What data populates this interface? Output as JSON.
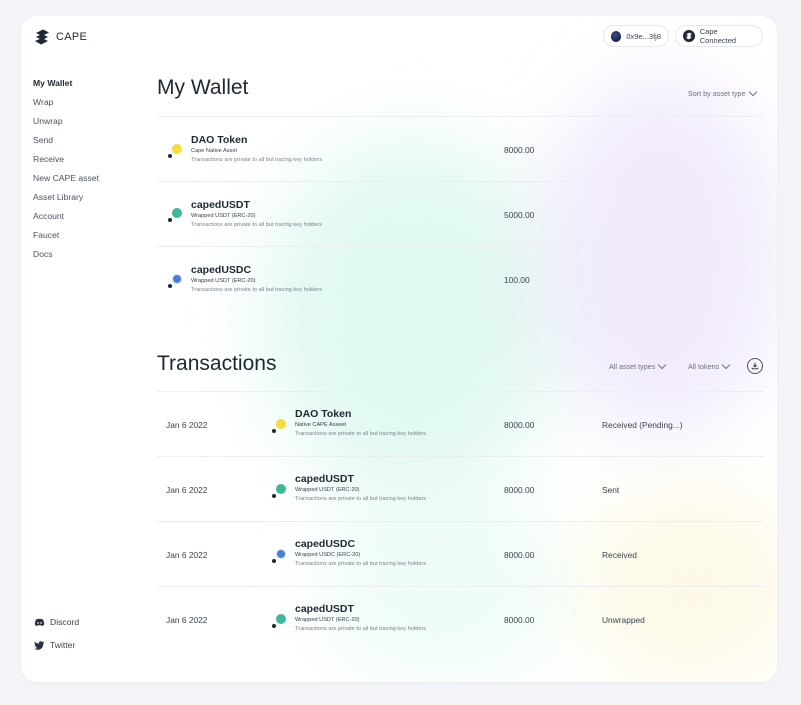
{
  "app": {
    "name": "CAPE"
  },
  "header": {
    "address": "0x9e...3fj8",
    "connection": "Cape Connected"
  },
  "nav": {
    "items": [
      {
        "label": "My Wallet",
        "active": true
      },
      {
        "label": "Wrap"
      },
      {
        "label": "Unwrap"
      },
      {
        "label": "Send"
      },
      {
        "label": "Receive"
      },
      {
        "label": "New CAPE asset"
      },
      {
        "label": "Asset Library"
      },
      {
        "label": "Account"
      },
      {
        "label": "Faucet"
      },
      {
        "label": "Docs"
      }
    ]
  },
  "social": {
    "discord": "Discord",
    "twitter": "Twitter"
  },
  "wallet": {
    "title": "My Wallet",
    "sort_label": "Sort by asset type",
    "assets": [
      {
        "name": "DAO Token",
        "subtitle": "Cape Native Asset",
        "note": "Transactions are private to all but tracing key holders",
        "amount": "8000.00",
        "icon": "dao-token-icon"
      },
      {
        "name": "capedUSDT",
        "subtitle": "Wrapped USDT (ERC-20)",
        "note": "Transactions are private to all but tracing key holders",
        "amount": "5000.00",
        "icon": "usdt-icon"
      },
      {
        "name": "capedUSDC",
        "subtitle": "Wrapped USDT (ERC-20)",
        "note": "Transactions are private to all but tracing key holders",
        "amount": "100.00",
        "icon": "usdc-icon"
      }
    ]
  },
  "transactions": {
    "title": "Transactions",
    "filter_types": "All asset types",
    "filter_tokens": "All tokens",
    "rows": [
      {
        "date": "Jan 6 2022",
        "name": "DAO Token",
        "subtitle": "Native CAPE Asseet",
        "note": "Transactions are private to all but tracing key holders",
        "amount": "8000.00",
        "status": "Received (Pending...)",
        "icon": "dao-token-icon"
      },
      {
        "date": "Jan 6 2022",
        "name": "capedUSDT",
        "subtitle": "Wrapped USDT (ERC-20)",
        "note": "Transactions are private to all but tracing key holders",
        "amount": "8000.00",
        "status": "Sent",
        "icon": "usdt-icon"
      },
      {
        "date": "Jan 6 2022",
        "name": "capedUSDC",
        "subtitle": "Wrapped USDC (ERC-20)",
        "note": "Transactions are private to all but tracing key holders",
        "amount": "8000.00",
        "status": "Received",
        "icon": "usdc-icon"
      },
      {
        "date": "Jan 6 2022",
        "name": "capedUSDT",
        "subtitle": "Wrapped USDT (ERC-20)",
        "note": "Transactions are private to all but tracing key holders",
        "amount": "8000.00",
        "status": "Unwrapped",
        "icon": "usdt-icon"
      }
    ]
  },
  "colors": {
    "text": "#1f2733",
    "dao": "#f5dc3a",
    "usdt": "#3fb79a",
    "usdc": "#4a7fd6"
  }
}
